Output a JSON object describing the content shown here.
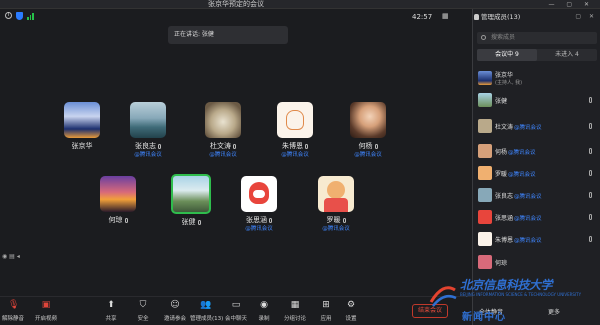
{
  "window": {
    "title": "张京华预定的会议"
  },
  "meeting": {
    "timer": "42:57",
    "view_label": "视图",
    "speaking_label": "正在讲话: 张健"
  },
  "tiles_row1": [
    {
      "name": "张京华",
      "tencent": ""
    },
    {
      "name": "张良志",
      "tencent": "@腾讯会议"
    },
    {
      "name": "杜文涛",
      "tencent": "@腾讯会议"
    },
    {
      "name": "朱博恩",
      "tencent": "@腾讯会议"
    },
    {
      "name": "何杨",
      "tencent": "@腾讯会议"
    }
  ],
  "tiles_row2": [
    {
      "name": "何琼",
      "tencent": ""
    },
    {
      "name": "张健",
      "tencent": ""
    },
    {
      "name": "张思涵",
      "tencent": "@腾讯会议"
    },
    {
      "name": "罗暖",
      "tencent": "@腾讯会议"
    }
  ],
  "toolbar": {
    "items": [
      "解除静音",
      "开启视频",
      "共享",
      "安全",
      "邀请参会",
      "管理成员(13)",
      "会中聊天",
      "录制",
      "分组讨论",
      "应用",
      "设置"
    ],
    "end_label": "结束会议"
  },
  "panel": {
    "title": "管理成员(13)",
    "search_placeholder": "搜索成员",
    "tab_in": "会议中 9",
    "tab_out": "未进入 4",
    "members": [
      {
        "name": "张京华",
        "sub": "(主持人, 我)",
        "tencent": ""
      },
      {
        "name": "张健",
        "sub": "",
        "tencent": ""
      },
      {
        "name": "杜文涛",
        "sub": "",
        "tencent": "@腾讯会议"
      },
      {
        "name": "何杨",
        "sub": "",
        "tencent": "@腾讯会议"
      },
      {
        "name": "罗暖",
        "sub": "",
        "tencent": "@腾讯会议"
      },
      {
        "name": "张良志",
        "sub": "",
        "tencent": "@腾讯会议"
      },
      {
        "name": "张思涵",
        "sub": "",
        "tencent": "@腾讯会议"
      },
      {
        "name": "朱博恩",
        "sub": "",
        "tencent": "@腾讯会议"
      },
      {
        "name": "何琼",
        "sub": "",
        "tencent": ""
      }
    ],
    "mute_all": "全体静音",
    "more": "更多"
  },
  "logo": {
    "text_cn": "北京信息科技大学",
    "text_en": "BEIJING INFORMATION SCIENCE & TECHNOLOGY UNIVERSITY",
    "text_news": "新闻中心"
  },
  "colors": {
    "accent": "#3f86ff",
    "speaking_border": "#2fbd4d",
    "end": "#e74c3c"
  }
}
